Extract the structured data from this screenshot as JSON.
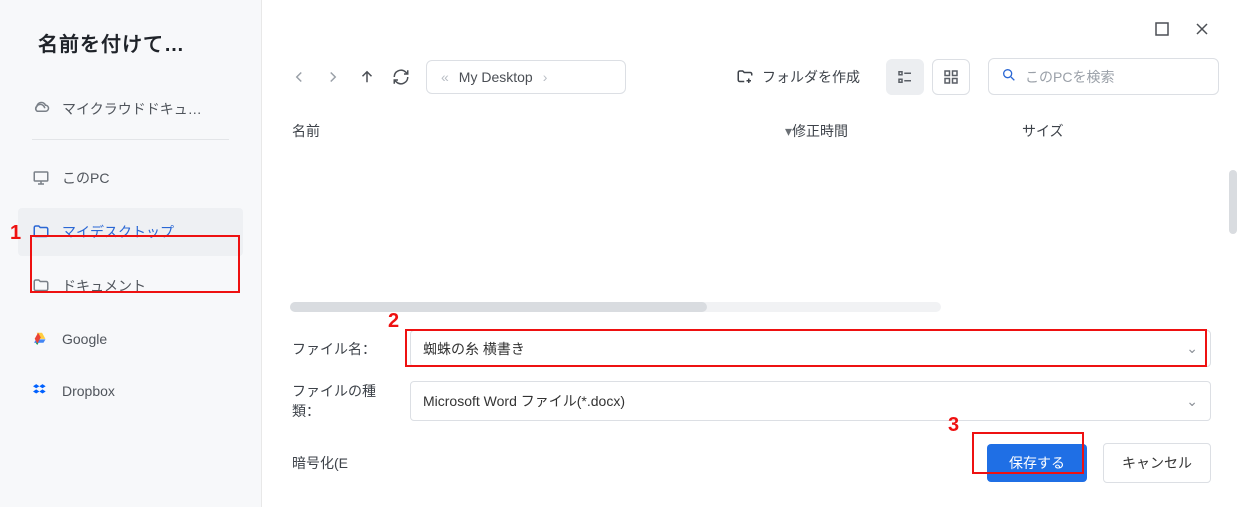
{
  "dialog": {
    "title": "名前を付けて…"
  },
  "sidebar": {
    "items": [
      {
        "label": "マイクラウドドキュ…",
        "icon": "cloud"
      },
      {
        "label": "このPC",
        "icon": "monitor"
      },
      {
        "label": "マイデスクトップ",
        "icon": "folder",
        "selected": true
      },
      {
        "label": "ドキュメント",
        "icon": "folder"
      },
      {
        "label": "Google",
        "icon": "google"
      },
      {
        "label": "Dropbox",
        "icon": "dropbox"
      }
    ]
  },
  "toolbar": {
    "breadcrumb": {
      "current": "My Desktop"
    },
    "create_folder": "フォルダを作成",
    "search_placeholder": "このPCを検索"
  },
  "columns": {
    "name": "名前",
    "mtime": "修正時間",
    "size": "サイズ"
  },
  "form": {
    "filename_label": "ファイル名：",
    "filename_value": "蜘蛛の糸 横書き",
    "filetype_label": "ファイルの種類：",
    "filetype_value": "Microsoft Word ファイル(*.docx)",
    "encrypt_label": "暗号化(E",
    "save_label": "保存する",
    "cancel_label": "キャンセル"
  },
  "annotations": {
    "n1": "1",
    "n2": "2",
    "n3": "3"
  }
}
